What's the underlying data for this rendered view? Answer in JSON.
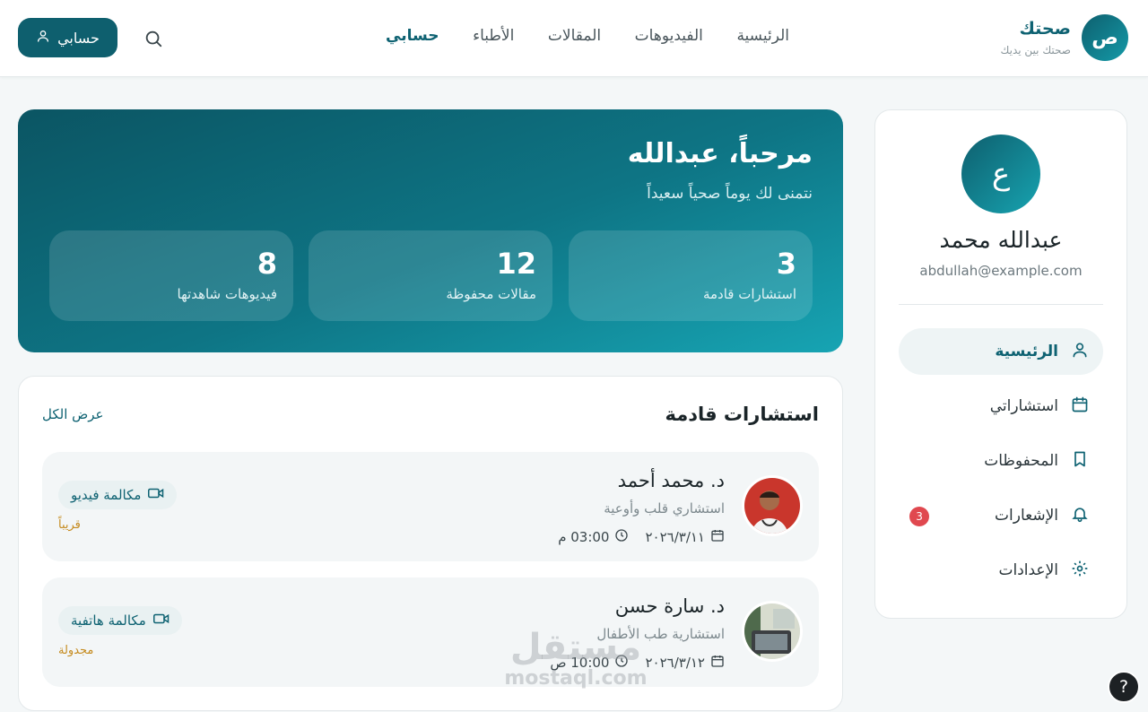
{
  "brand": {
    "logo_letter": "ص",
    "name": "صحتك",
    "tagline": "صحتك بين يديك"
  },
  "nav": {
    "items": [
      {
        "label": "الرئيسية"
      },
      {
        "label": "الفيديوهات"
      },
      {
        "label": "المقالات"
      },
      {
        "label": "الأطباء"
      },
      {
        "label": "حسابي",
        "active": true
      }
    ]
  },
  "header": {
    "account_label": "حسابي"
  },
  "profile": {
    "avatar_letter": "ع",
    "name": "عبدالله محمد",
    "email": "abdullah@example.com"
  },
  "sidebar": {
    "items": [
      {
        "label": "الرئيسية",
        "icon": "user-icon",
        "active": true
      },
      {
        "label": "استشاراتي",
        "icon": "calendar-icon"
      },
      {
        "label": "المحفوظات",
        "icon": "bookmark-icon"
      },
      {
        "label": "الإشعارات",
        "icon": "bell-icon",
        "badge": "3"
      },
      {
        "label": "الإعدادات",
        "icon": "gear-icon"
      }
    ]
  },
  "hero": {
    "title": "مرحباً، عبدالله",
    "subtitle": "نتمنى لك يوماً صحياً سعيداً",
    "stats": [
      {
        "value": "3",
        "label": "استشارات قادمة"
      },
      {
        "value": "12",
        "label": "مقالات محفوظة"
      },
      {
        "value": "8",
        "label": "فيديوهات شاهدتها"
      }
    ]
  },
  "consultations": {
    "title": "استشارات قادمة",
    "view_all": "عرض الكل",
    "items": [
      {
        "doctor": "د. محمد أحمد",
        "specialty": "استشاري قلب وأوعية",
        "date": "٢٠٢٦/٣/١١",
        "time": "03:00 م",
        "call_type": "مكالمة فيديو",
        "status": "قريباً"
      },
      {
        "doctor": "د. سارة حسن",
        "specialty": "استشارية طب الأطفال",
        "date": "٢٠٢٦/٣/١٢",
        "time": "10:00 ص",
        "call_type": "مكالمة هاتفية",
        "status": "مجدولة"
      }
    ]
  },
  "watermark": {
    "arabic": "مستقل",
    "latin": "mostaql.com"
  },
  "help": {
    "label": "?"
  },
  "colors": {
    "primary": "#0e5f6e",
    "accent": "#17a4b3",
    "badge": "#e0484f",
    "status": "#c58b1f"
  }
}
